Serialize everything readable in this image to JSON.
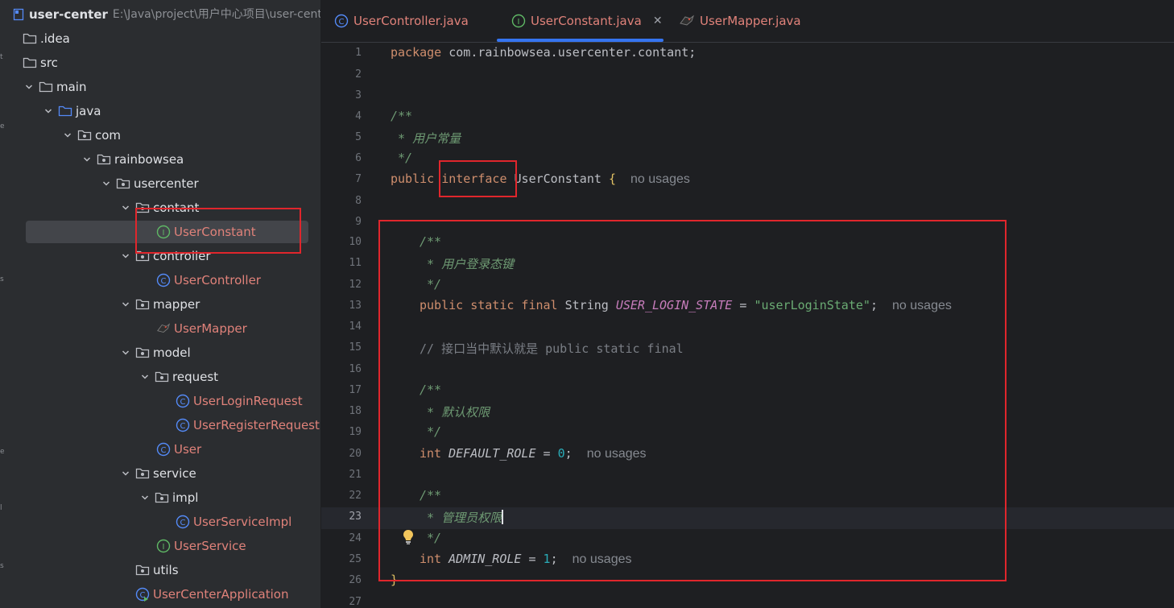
{
  "toolstrip": {
    "letters": [
      "t",
      "e",
      "s",
      "e",
      "l",
      "s"
    ]
  },
  "project": {
    "root_name": "user-center",
    "root_path": "E:\\Java\\project\\用户中心项目\\user-cent",
    "tree": [
      {
        "label": "user-center",
        "depth": 0,
        "kind": "root"
      },
      {
        "label": ".idea",
        "depth": 0,
        "kind": "folder",
        "chevron": false
      },
      {
        "label": "src",
        "depth": 0,
        "kind": "folder",
        "chevron": false
      },
      {
        "label": "main",
        "depth": 1,
        "kind": "folder",
        "chevron": true
      },
      {
        "label": "java",
        "depth": 2,
        "kind": "folder-blue",
        "chevron": true
      },
      {
        "label": "com",
        "depth": 3,
        "kind": "package",
        "chevron": true
      },
      {
        "label": "rainbowsea",
        "depth": 4,
        "kind": "package",
        "chevron": true
      },
      {
        "label": "usercenter",
        "depth": 5,
        "kind": "package",
        "chevron": true
      },
      {
        "label": "contant",
        "depth": 6,
        "kind": "package",
        "chevron": true
      },
      {
        "label": "UserConstant",
        "depth": 7,
        "kind": "interface",
        "selected": true
      },
      {
        "label": "controller",
        "depth": 6,
        "kind": "package",
        "chevron": true
      },
      {
        "label": "UserController",
        "depth": 7,
        "kind": "class"
      },
      {
        "label": "mapper",
        "depth": 6,
        "kind": "package",
        "chevron": true
      },
      {
        "label": "UserMapper",
        "depth": 7,
        "kind": "mybatis"
      },
      {
        "label": "model",
        "depth": 6,
        "kind": "package",
        "chevron": true
      },
      {
        "label": "request",
        "depth": 7,
        "kind": "package",
        "chevron": true
      },
      {
        "label": "UserLoginRequest",
        "depth": 8,
        "kind": "class"
      },
      {
        "label": "UserRegisterRequest",
        "depth": 8,
        "kind": "class"
      },
      {
        "label": "User",
        "depth": 7,
        "kind": "class"
      },
      {
        "label": "service",
        "depth": 6,
        "kind": "package",
        "chevron": true
      },
      {
        "label": "impl",
        "depth": 7,
        "kind": "package",
        "chevron": true
      },
      {
        "label": "UserServiceImpl",
        "depth": 8,
        "kind": "class"
      },
      {
        "label": "UserService",
        "depth": 7,
        "kind": "interface"
      },
      {
        "label": "utils",
        "depth": 6,
        "kind": "package",
        "chevron": false
      },
      {
        "label": "UserCenterApplication",
        "depth": 6,
        "kind": "app"
      }
    ]
  },
  "tabs": [
    {
      "label": "UserController.java",
      "kind": "class",
      "active": false
    },
    {
      "label": "UserConstant.java",
      "kind": "interface",
      "active": true,
      "close": "✕"
    },
    {
      "label": "UserMapper.java",
      "kind": "mybatis",
      "active": false
    }
  ],
  "editor": {
    "line_numbers": [
      "1",
      "2",
      "3",
      "4",
      "5",
      "6",
      "7",
      "8",
      "9",
      "10",
      "11",
      "12",
      "13",
      "14",
      "15",
      "16",
      "17",
      "18",
      "19",
      "20",
      "21",
      "22",
      "23",
      "24",
      "25",
      "26",
      "27"
    ],
    "lines": {
      "l1": {
        "kw": "package",
        "rest": " com.rainbowsea.usercenter.contant;"
      },
      "l4": "/**",
      "l5": " * 用户常量",
      "l6": " */",
      "l7": {
        "kw1": "public",
        "kw2": "interface",
        "name": " UserConstant ",
        "brace": "{",
        "hint": "no usages"
      },
      "l10": "/**",
      "l11": " * 用户登录态键",
      "l12": " */",
      "l13": {
        "kw": "public static final",
        "type": " String ",
        "const": "USER_LOGIN_STATE",
        "eq": " = ",
        "str": "\"userLoginState\"",
        "semi": ";",
        "hint": "no usages"
      },
      "l15": "// 接口当中默认就是 public static final",
      "l17": "/**",
      "l18": " * 默认权限",
      "l19": " */",
      "l20": {
        "kw": "int",
        "const": "DEFAULT_ROLE",
        "eq": " = ",
        "num": "0",
        "semi": ";",
        "hint": "no usages"
      },
      "l22": "/**",
      "l23": " * 管理员权限",
      "l24": " */",
      "l25": {
        "kw": "int",
        "const": "ADMIN_ROLE",
        "eq": " = ",
        "num": "1",
        "semi": ";",
        "hint": "no usages"
      },
      "l26": "}"
    }
  },
  "colors": {
    "accent": "#3574f0",
    "annotation_red": "#e0262c"
  }
}
